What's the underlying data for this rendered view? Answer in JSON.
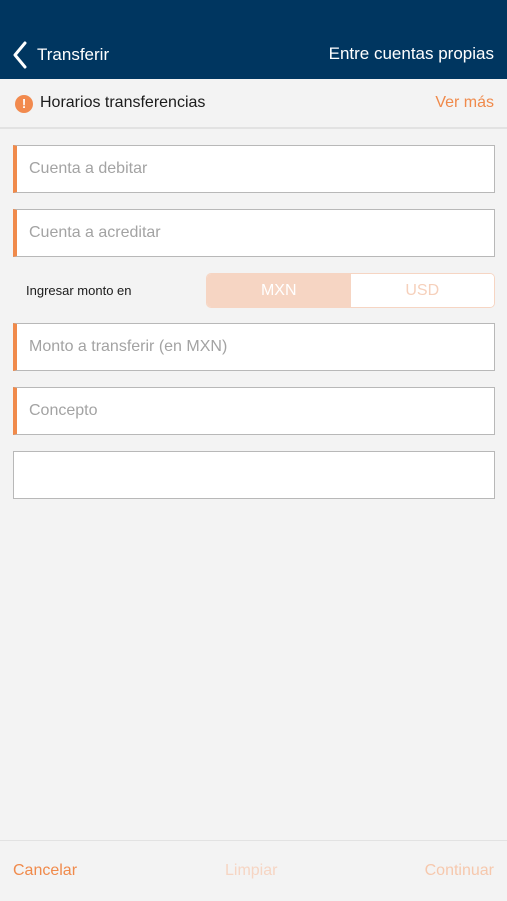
{
  "header": {
    "back_label": "Transferir",
    "title": "Entre cuentas propias"
  },
  "info_bar": {
    "icon": "info-icon",
    "icon_glyph": "!",
    "text": "Horarios transferencias",
    "link": "Ver más"
  },
  "form": {
    "debit_account": {
      "placeholder": "Cuenta a debitar",
      "value": ""
    },
    "credit_account": {
      "placeholder": "Cuenta a acreditar",
      "value": ""
    },
    "amount_currency": {
      "label": "Ingresar monto en",
      "options": [
        "MXN",
        "USD"
      ],
      "selected": "MXN"
    },
    "amount": {
      "placeholder": "Monto a transferir (en MXN)",
      "value": ""
    },
    "concept": {
      "placeholder": "Concepto",
      "value": ""
    },
    "extra": {
      "placeholder": "",
      "value": ""
    }
  },
  "footer": {
    "cancel": "Cancelar",
    "clear": "Limpiar",
    "continue": "Continuar"
  },
  "colors": {
    "header_bg": "#003660",
    "accent": "#f08a4b",
    "accent_light": "#f6d5c3",
    "background": "#f3f3f3"
  }
}
